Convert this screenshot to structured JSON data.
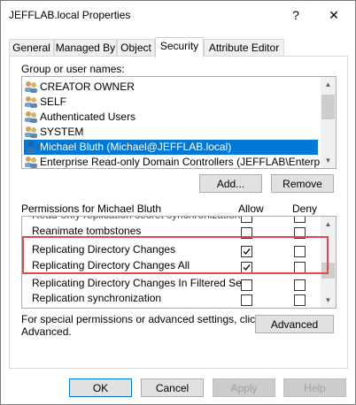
{
  "window": {
    "title": "JEFFLAB.local Properties",
    "help_glyph": "?",
    "close_glyph": "✕"
  },
  "tabs": [
    {
      "label": "General"
    },
    {
      "label": "Managed By"
    },
    {
      "label": "Object"
    },
    {
      "label": "Security",
      "active": true
    },
    {
      "label": "Attribute Editor"
    }
  ],
  "security": {
    "group_label": "Group or user names:",
    "principals": [
      {
        "name": "CREATOR OWNER",
        "icon": "group-icon"
      },
      {
        "name": "SELF",
        "icon": "group-icon"
      },
      {
        "name": "Authenticated Users",
        "icon": "group-icon"
      },
      {
        "name": "SYSTEM",
        "icon": "group-icon"
      },
      {
        "name": "Michael Bluth (Michael@JEFFLAB.local)",
        "icon": "user-icon",
        "selected": true
      },
      {
        "name": "Enterprise Read-only Domain Controllers (JEFFLAB\\Enterprise R...",
        "icon": "group-icon"
      }
    ],
    "add_label": "Add...",
    "remove_label": "Remove",
    "permissions_label": "Permissions for Michael Bluth",
    "allow_label": "Allow",
    "deny_label": "Deny",
    "permissions": [
      {
        "name": "Read-only replication secret synchronization",
        "allow": false,
        "deny": false
      },
      {
        "name": "Reanimate tombstones",
        "allow": false,
        "deny": false
      },
      {
        "name": "Replicating Directory Changes",
        "allow": true,
        "deny": false
      },
      {
        "name": "Replicating Directory Changes All",
        "allow": true,
        "deny": false
      },
      {
        "name": "Replicating Directory Changes In Filtered Set",
        "allow": false,
        "deny": false
      },
      {
        "name": "Replication synchronization",
        "allow": false,
        "deny": false
      }
    ],
    "advanced_text_1": "For special permissions or advanced settings, click",
    "advanced_text_2": "Advanced.",
    "advanced_label": "Advanced"
  },
  "footer": {
    "ok": "OK",
    "cancel": "Cancel",
    "apply": "Apply",
    "help": "Help"
  },
  "colors": {
    "selection": "#0078d7",
    "highlight_box": "#e04a4a"
  }
}
